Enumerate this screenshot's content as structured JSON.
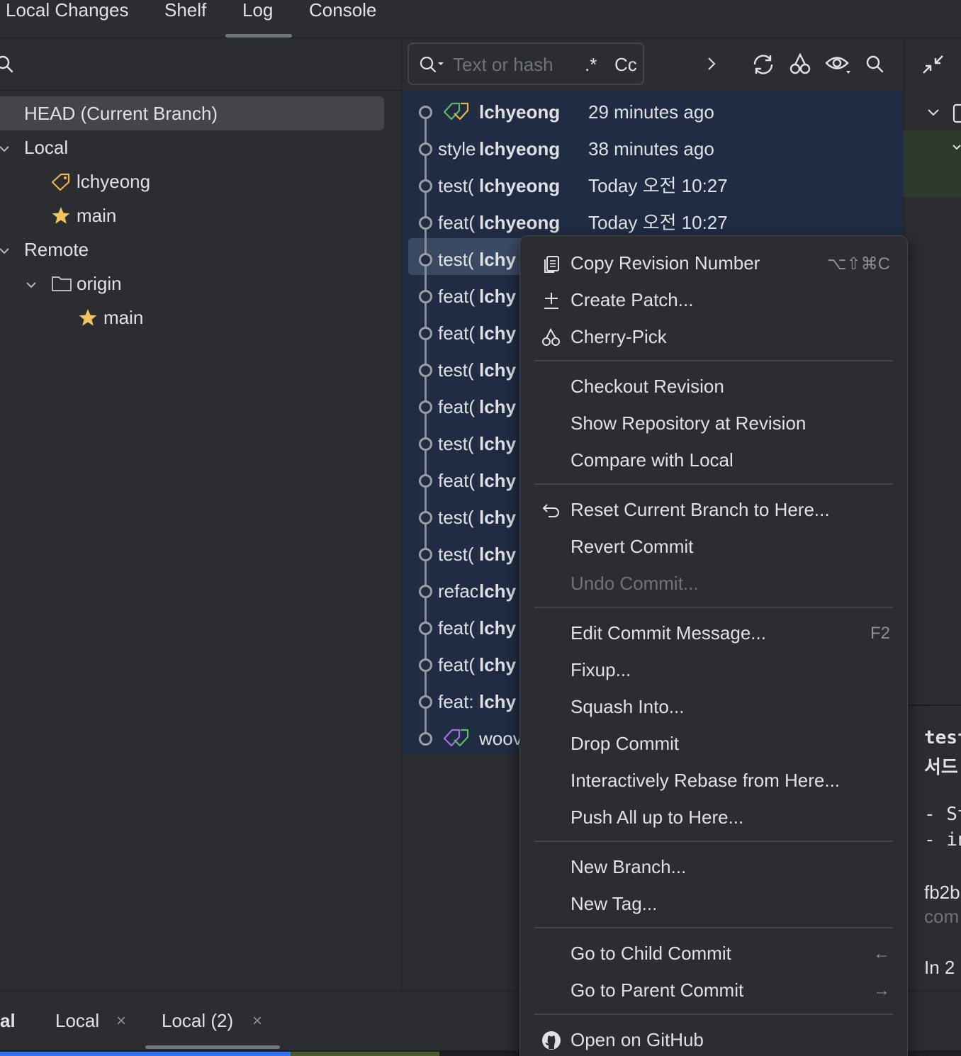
{
  "tabs": {
    "local_changes": "Local Changes",
    "shelf": "Shelf",
    "log": "Log",
    "console": "Console"
  },
  "branches": {
    "head": "HEAD (Current Branch)",
    "local_label": "Local",
    "local_items": [
      "lchyeong",
      "main"
    ],
    "remote_label": "Remote",
    "origin_label": "origin",
    "origin_items": [
      "main"
    ]
  },
  "log_search": {
    "placeholder": "Text or hash",
    "regex": ".*",
    "case": "Cc"
  },
  "commits": [
    {
      "msg": "",
      "author": "lchyeong",
      "date": "29 minutes ago"
    },
    {
      "msg": "style",
      "author": "lchyeong",
      "date": "38 minutes ago"
    },
    {
      "msg": "test(",
      "author": "lchyeong",
      "date": "Today 오전 10:27"
    },
    {
      "msg": "feat(",
      "author": "lchyeong",
      "date": "Today 오전 10:27"
    },
    {
      "msg": "test(",
      "author": "lchy",
      "date": ""
    },
    {
      "msg": "feat(",
      "author": "lchy",
      "date": ""
    },
    {
      "msg": "feat(",
      "author": "lchy",
      "date": ""
    },
    {
      "msg": "test(",
      "author": "lchy",
      "date": ""
    },
    {
      "msg": "feat(",
      "author": "lchy",
      "date": ""
    },
    {
      "msg": "test(",
      "author": "lchy",
      "date": ""
    },
    {
      "msg": "feat(",
      "author": "lchy",
      "date": ""
    },
    {
      "msg": "test(",
      "author": "lchy",
      "date": ""
    },
    {
      "msg": "test(",
      "author": "lchy",
      "date": ""
    },
    {
      "msg": "refac",
      "author": "lchy",
      "date": ""
    },
    {
      "msg": "feat(",
      "author": "lchy",
      "date": ""
    },
    {
      "msg": "feat(",
      "author": "lchy",
      "date": ""
    },
    {
      "msg": "feat:",
      "author": "lchy",
      "date": ""
    },
    {
      "msg": "",
      "author": "woov",
      "date": ""
    }
  ],
  "context_menu": {
    "copy_revision": "Copy Revision Number",
    "copy_revision_shortcut": "⌥⇧⌘C",
    "create_patch": "Create Patch...",
    "cherry_pick": "Cherry-Pick",
    "checkout_revision": "Checkout Revision",
    "show_repo": "Show Repository at Revision",
    "compare_local": "Compare with Local",
    "reset_branch": "Reset Current Branch to Here...",
    "revert_commit": "Revert Commit",
    "undo_commit": "Undo Commit...",
    "edit_message": "Edit Commit Message...",
    "edit_message_shortcut": "F2",
    "fixup": "Fixup...",
    "squash": "Squash Into...",
    "drop": "Drop Commit",
    "rebase": "Interactively Rebase from Here...",
    "push_all": "Push All up to Here...",
    "new_branch": "New Branch...",
    "new_tag": "New Tag...",
    "go_child": "Go to Child Commit",
    "go_child_shortcut": "←",
    "go_parent": "Go to Parent Commit",
    "go_parent_shortcut": "→",
    "open_github": "Open on GitHub"
  },
  "details": {
    "line1": "test",
    "line2": "서드",
    "bullet1": "- St",
    "bullet2": "- in",
    "hash": "fb2b",
    "committer": "com",
    "in_branches": "In 2"
  },
  "bottom_tabs": {
    "partial": "al",
    "local": "Local",
    "local2": "Local (2)",
    "close": "×"
  },
  "colors": {
    "background": "#2b2d30",
    "selection": "#1f2c43",
    "accent_blue": "#3574f0",
    "tag_yellow": "#e8b44c",
    "tag_green": "#5fb865",
    "tag_purple": "#a66ee0",
    "star": "#f2c55c"
  }
}
